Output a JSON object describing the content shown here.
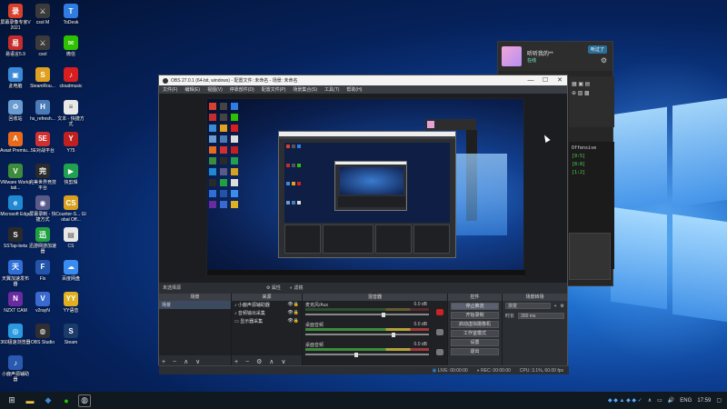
{
  "desktop": {
    "icons": [
      {
        "label": "屏幕录像专家V2021",
        "icon": "recorder-icon",
        "color": "#d7402b",
        "glyph": "录"
      },
      {
        "label": "csol M",
        "icon": "csol-icon",
        "color": "#3a3a3a",
        "glyph": "⚔"
      },
      {
        "label": "ToDesk",
        "icon": "todesk-icon",
        "color": "#2f7de1",
        "glyph": "T"
      },
      {
        "label": "易语言5.9",
        "icon": "eyuyan-icon",
        "color": "#c72c2c",
        "glyph": "易"
      },
      {
        "label": "csol",
        "icon": "csol-icon",
        "color": "#3a3a3a",
        "glyph": "⚔"
      },
      {
        "label": "微信",
        "icon": "wechat-icon",
        "color": "#2dc100",
        "glyph": "✉"
      },
      {
        "label": "此电脑",
        "icon": "computer-icon",
        "color": "#3b8ad8",
        "glyph": "▣"
      },
      {
        "label": "SteamRou...",
        "icon": "steamrouter-icon",
        "color": "#e0a020",
        "glyph": "S"
      },
      {
        "label": "cloudmusic",
        "icon": "cloudmusic-icon",
        "color": "#d81e1e",
        "glyph": "♪"
      },
      {
        "label": "回收站",
        "icon": "recycle-bin-icon",
        "color": "#6a9bd1",
        "glyph": "♻"
      },
      {
        "label": "hs_refresh...",
        "icon": "hs-refresh-icon",
        "color": "#4a7ab8",
        "glyph": "H"
      },
      {
        "label": "文本 - 快捷方式",
        "icon": "text-shortcut-icon",
        "color": "#e8e8e8",
        "glyph": "≡"
      },
      {
        "label": "Avast Premiu...",
        "icon": "avast-icon",
        "color": "#e86a1a",
        "glyph": "A"
      },
      {
        "label": "5E对战平台",
        "icon": "5e-icon",
        "color": "#d03030",
        "glyph": "5E"
      },
      {
        "label": "Y75",
        "icon": "y75-icon",
        "color": "#c02020",
        "glyph": "Y"
      },
      {
        "label": "VMware Workstati...",
        "icon": "vmware-icon",
        "color": "#3c8c3c",
        "glyph": "V"
      },
      {
        "label": "完美世界竞技平台",
        "icon": "perfectworld-icon",
        "color": "#2a2a2a",
        "glyph": "完"
      },
      {
        "label": "快剪辑",
        "icon": "kuaijianji-icon",
        "color": "#20a050",
        "glyph": "▶"
      },
      {
        "label": "Microsoft Edge",
        "icon": "edge-icon",
        "color": "#1f8ad3",
        "glyph": "e"
      },
      {
        "label": "屏幕录制 - 快捷方式",
        "icon": "screen-record-icon",
        "color": "#5a5a8a",
        "glyph": "◉"
      },
      {
        "label": "Counter-S... Global Off...",
        "icon": "csgo-icon",
        "color": "#d9a020",
        "glyph": "CS"
      },
      {
        "label": "SSTap-beta",
        "icon": "sstap-icon",
        "color": "#2a2a2a",
        "glyph": "S"
      },
      {
        "label": "迅游网游加速器",
        "icon": "xunyou-icon",
        "color": "#20a040",
        "glyph": "迅"
      },
      {
        "label": "CS",
        "icon": "cs-doc-icon",
        "color": "#e8e8e8",
        "glyph": "▤"
      },
      {
        "label": "天翼加速发布器",
        "icon": "tianyi-icon",
        "color": "#2f6fd6",
        "glyph": "天"
      },
      {
        "label": "Flx",
        "icon": "flx-icon",
        "color": "#2255aa",
        "glyph": "F"
      },
      {
        "label": "百度网盘",
        "icon": "baidupan-icon",
        "color": "#3a8cf0",
        "glyph": "☁"
      },
      {
        "label": "NZXT CAM",
        "icon": "nzxt-icon",
        "color": "#6a2aa0",
        "glyph": "N"
      },
      {
        "label": "v2rayN",
        "icon": "v2ray-icon",
        "color": "#3a6ad0",
        "glyph": "V"
      },
      {
        "label": "YY语音",
        "icon": "yy-icon",
        "color": "#e0b020",
        "glyph": "YY"
      },
      {
        "label": "360极速浏览器",
        "icon": "360browser-icon",
        "color": "#2a9ae0",
        "glyph": "◎"
      },
      {
        "label": "OBS Studio",
        "icon": "obs-icon",
        "color": "#302e31",
        "glyph": "◍"
      },
      {
        "label": "Steam",
        "icon": "steam-icon",
        "color": "#1b3b6a",
        "glyph": "S"
      },
      {
        "label": "小鹿声源辅助器",
        "icon": "xiaolu-icon",
        "color": "#2a5ab0",
        "glyph": "♪"
      }
    ]
  },
  "chat": {
    "username": "听听我的**",
    "status": "在线",
    "badge": "听过了",
    "term_title": "Offensive",
    "term_lines": [
      "[9:5]",
      "[8:8]",
      "[1:2]"
    ]
  },
  "obs": {
    "title": "OBS 27.0.1 (64-bit, windows) - 配置文件: 未命名 - 场景: 未命名",
    "menu": [
      "文件(F)",
      "编辑(E)",
      "视图(V)",
      "停靠部件(D)",
      "配置文件(P)",
      "场景集合(S)",
      "工具(T)",
      "帮助(H)"
    ],
    "window_controls": [
      "—",
      "☐",
      "✕"
    ],
    "scene_label": "未选择源",
    "scene_buttons": [
      "属性",
      "滤镜"
    ],
    "docks": {
      "scenes_header": "场景",
      "scenes": [
        "场景"
      ],
      "sources_header": "来源",
      "sources": [
        "小鹿声源辅助器",
        "音频输出采集",
        "显示器采集"
      ],
      "mixer_header": "混音器",
      "mixer": [
        {
          "name": "麦克风/Aux",
          "db": "0.0 dB",
          "level": 0.62,
          "muted": true
        },
        {
          "name": "桌面音频",
          "db": "0.0 dB",
          "level": 0.7,
          "muted": false
        },
        {
          "name": "桌面音频",
          "db": "0.0 dB",
          "level": 0.4,
          "muted": false
        }
      ],
      "transitions_header": "场景转场",
      "transition_type": "渐变",
      "duration_label": "时长",
      "duration_value": "300 ms",
      "controls_header": "控件",
      "controls": [
        "停止推流",
        "开始录制",
        "启动虚拟摄像机",
        "工作室模式",
        "设置",
        "退出"
      ]
    },
    "status": {
      "live": "LIVE: 00:00:00",
      "rec": "REC: 00:00:00",
      "cpu": "CPU: 3.1%, 60.00 fps"
    }
  },
  "taskbar": {
    "start_icon": "windows-start-icon",
    "lang": "ENG",
    "clock": "17:59"
  }
}
